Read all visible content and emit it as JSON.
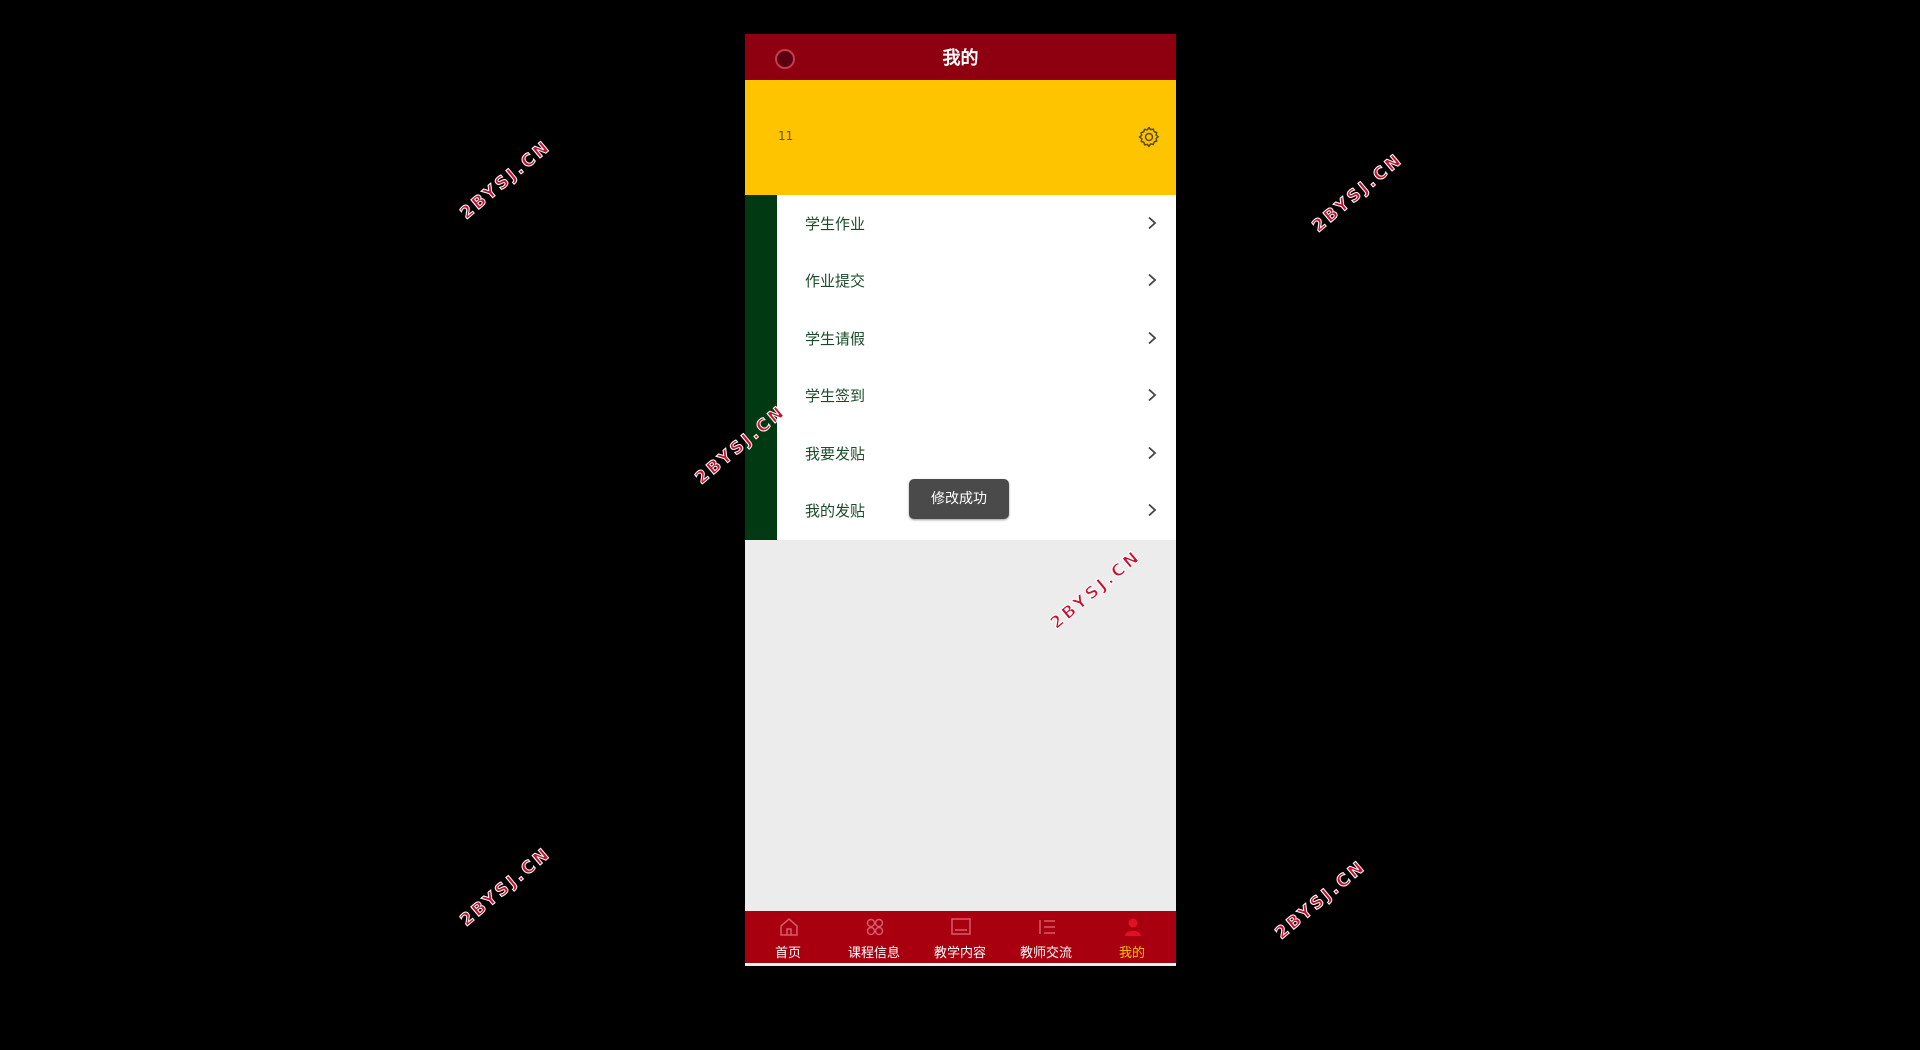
{
  "header": {
    "title": "我的"
  },
  "profile": {
    "name": "11"
  },
  "menu": {
    "items": [
      {
        "label": "学生作业"
      },
      {
        "label": "作业提交"
      },
      {
        "label": "学生请假"
      },
      {
        "label": "学生签到"
      },
      {
        "label": "我要发贴"
      },
      {
        "label": "我的发贴"
      }
    ]
  },
  "toast": {
    "message": "修改成功"
  },
  "tabbar": {
    "tabs": [
      {
        "label": "首页",
        "icon": "home-icon"
      },
      {
        "label": "课程信息",
        "icon": "command-icon"
      },
      {
        "label": "教学内容",
        "icon": "screen-icon"
      },
      {
        "label": "教师交流",
        "icon": "list-icon"
      },
      {
        "label": "我的",
        "icon": "user-icon",
        "active": true
      }
    ]
  },
  "watermark": {
    "text": "2BYSJ.CN"
  },
  "colors": {
    "header": "#8e0010",
    "profile_bg": "#ffc400",
    "sidebar_accent": "#013a12",
    "tabbar": "#a8000f",
    "tab_active": "#ffc400"
  }
}
